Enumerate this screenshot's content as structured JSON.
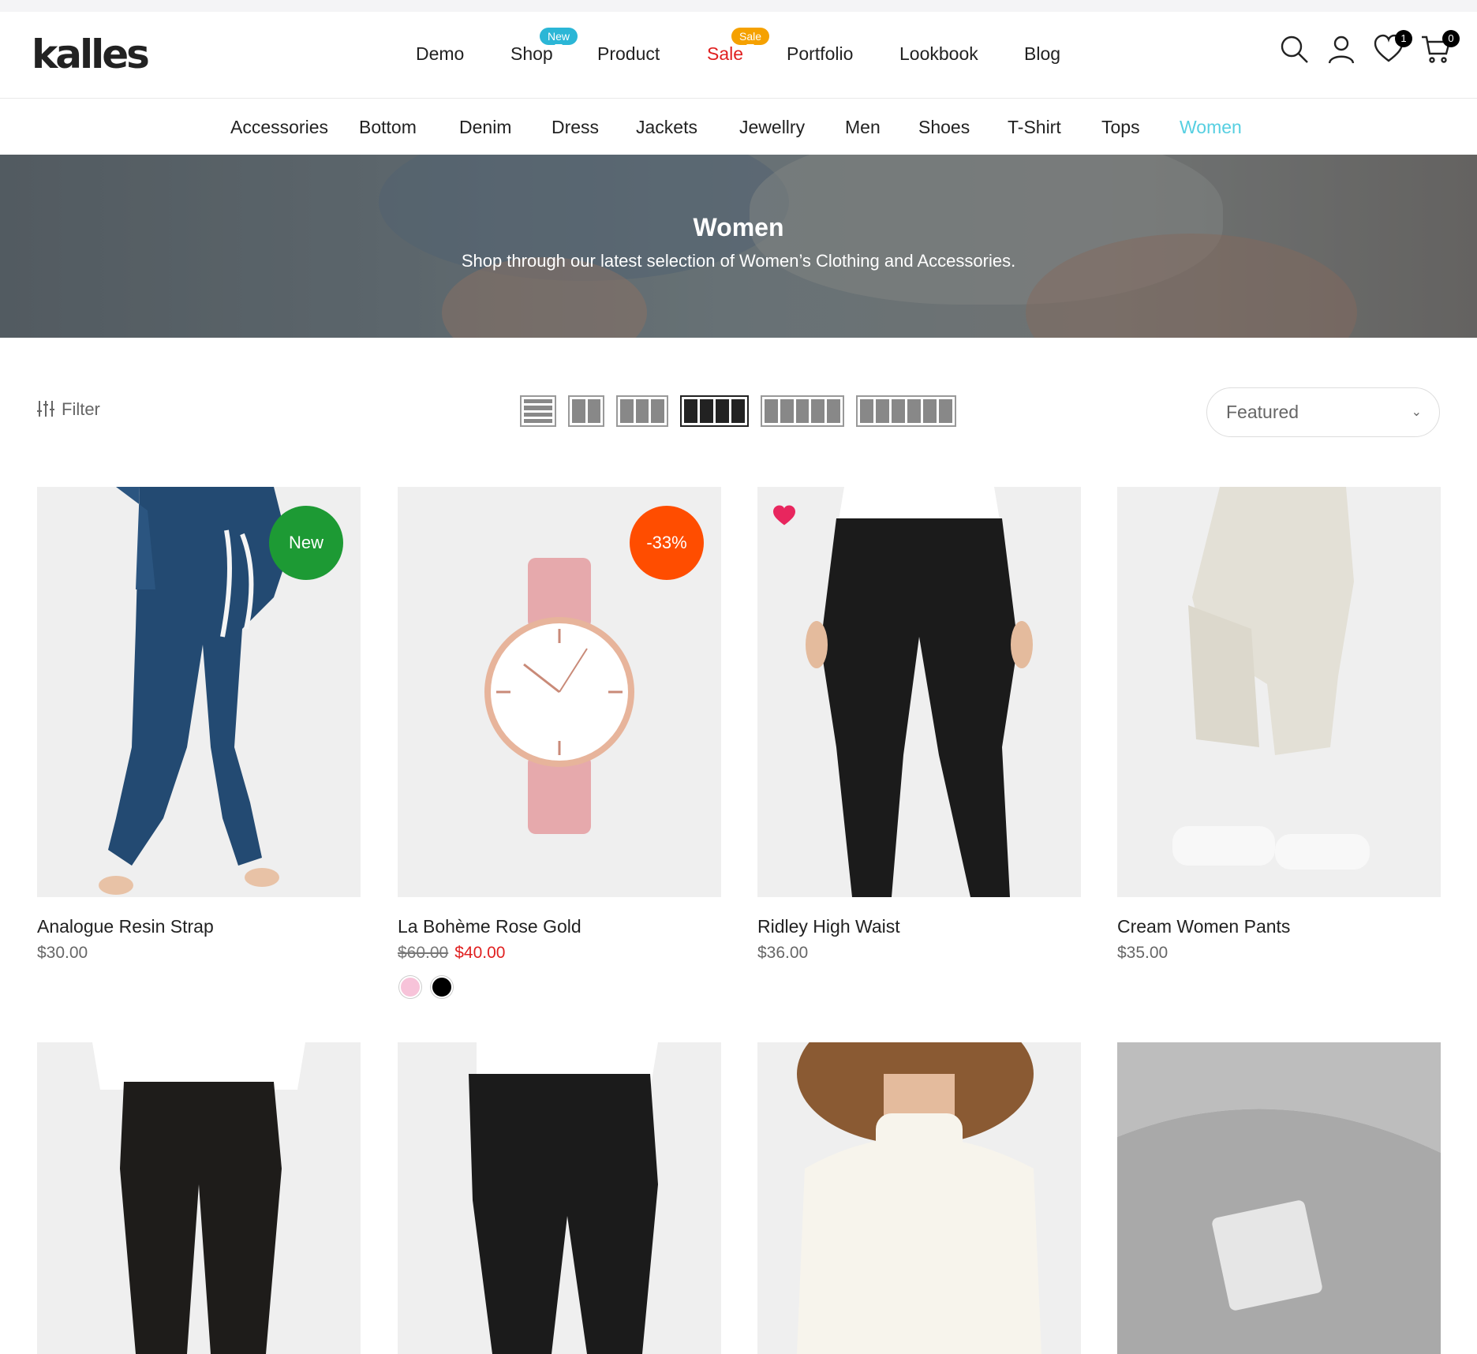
{
  "brand": {
    "logo": "kalles"
  },
  "main_nav": [
    {
      "label": "Demo"
    },
    {
      "label": "Shop",
      "badge": "New",
      "badge_color": "#2bb6d6"
    },
    {
      "label": "Product"
    },
    {
      "label": "Sale",
      "badge": "Sale",
      "badge_color": "#f5a100",
      "color": "#e02020"
    },
    {
      "label": "Portfolio"
    },
    {
      "label": "Lookbook"
    },
    {
      "label": "Blog"
    }
  ],
  "header_icons": {
    "search": "search-icon",
    "account": "user-icon",
    "wishlist": {
      "icon": "heart-icon",
      "count": "1"
    },
    "cart": {
      "icon": "cart-icon",
      "count": "0"
    }
  },
  "categories": [
    {
      "label": "Accessories"
    },
    {
      "label": "Bottom"
    },
    {
      "label": "Denim"
    },
    {
      "label": "Dress"
    },
    {
      "label": "Jackets"
    },
    {
      "label": "Jewellry"
    },
    {
      "label": "Men"
    },
    {
      "label": "Shoes"
    },
    {
      "label": "T-Shirt"
    },
    {
      "label": "Tops"
    },
    {
      "label": "Women",
      "active": true
    }
  ],
  "hero": {
    "title": "Women",
    "subtitle": "Shop through our latest selection of Women’s Clothing and Accessories."
  },
  "toolbar": {
    "filter_label": "Filter",
    "layout_options": [
      1,
      2,
      3,
      4,
      5,
      6
    ],
    "active_layout": 4,
    "sort_value": "Featured"
  },
  "products": [
    {
      "title": "Analogue Resin Strap",
      "price": "$30.00",
      "badge": "New",
      "badge_color": "#1d9a34",
      "image": "navy-jogger-pants"
    },
    {
      "title": "La Bohème Rose Gold",
      "old_price": "$60.00",
      "price": "$40.00",
      "badge": "-33%",
      "badge_color": "#ff4d00",
      "image": "rose-gold-watch",
      "swatches": [
        "#f7c3d9",
        "#000000"
      ]
    },
    {
      "title": "Ridley High Waist",
      "price": "$36.00",
      "wishlisted": true,
      "image": "black-high-waist-pants"
    },
    {
      "title": "Cream Women Pants",
      "price": "$35.00",
      "image": "cream-jogger-pants"
    },
    {
      "image": "black-cargo-pants"
    },
    {
      "image": "black-trousers"
    },
    {
      "image": "cream-ribbed-sweater"
    },
    {
      "image": "grey-knit-beanie"
    }
  ],
  "colors": {
    "accent": "#56cfe1",
    "sale": "#e02020",
    "heart": "#e8265e"
  }
}
